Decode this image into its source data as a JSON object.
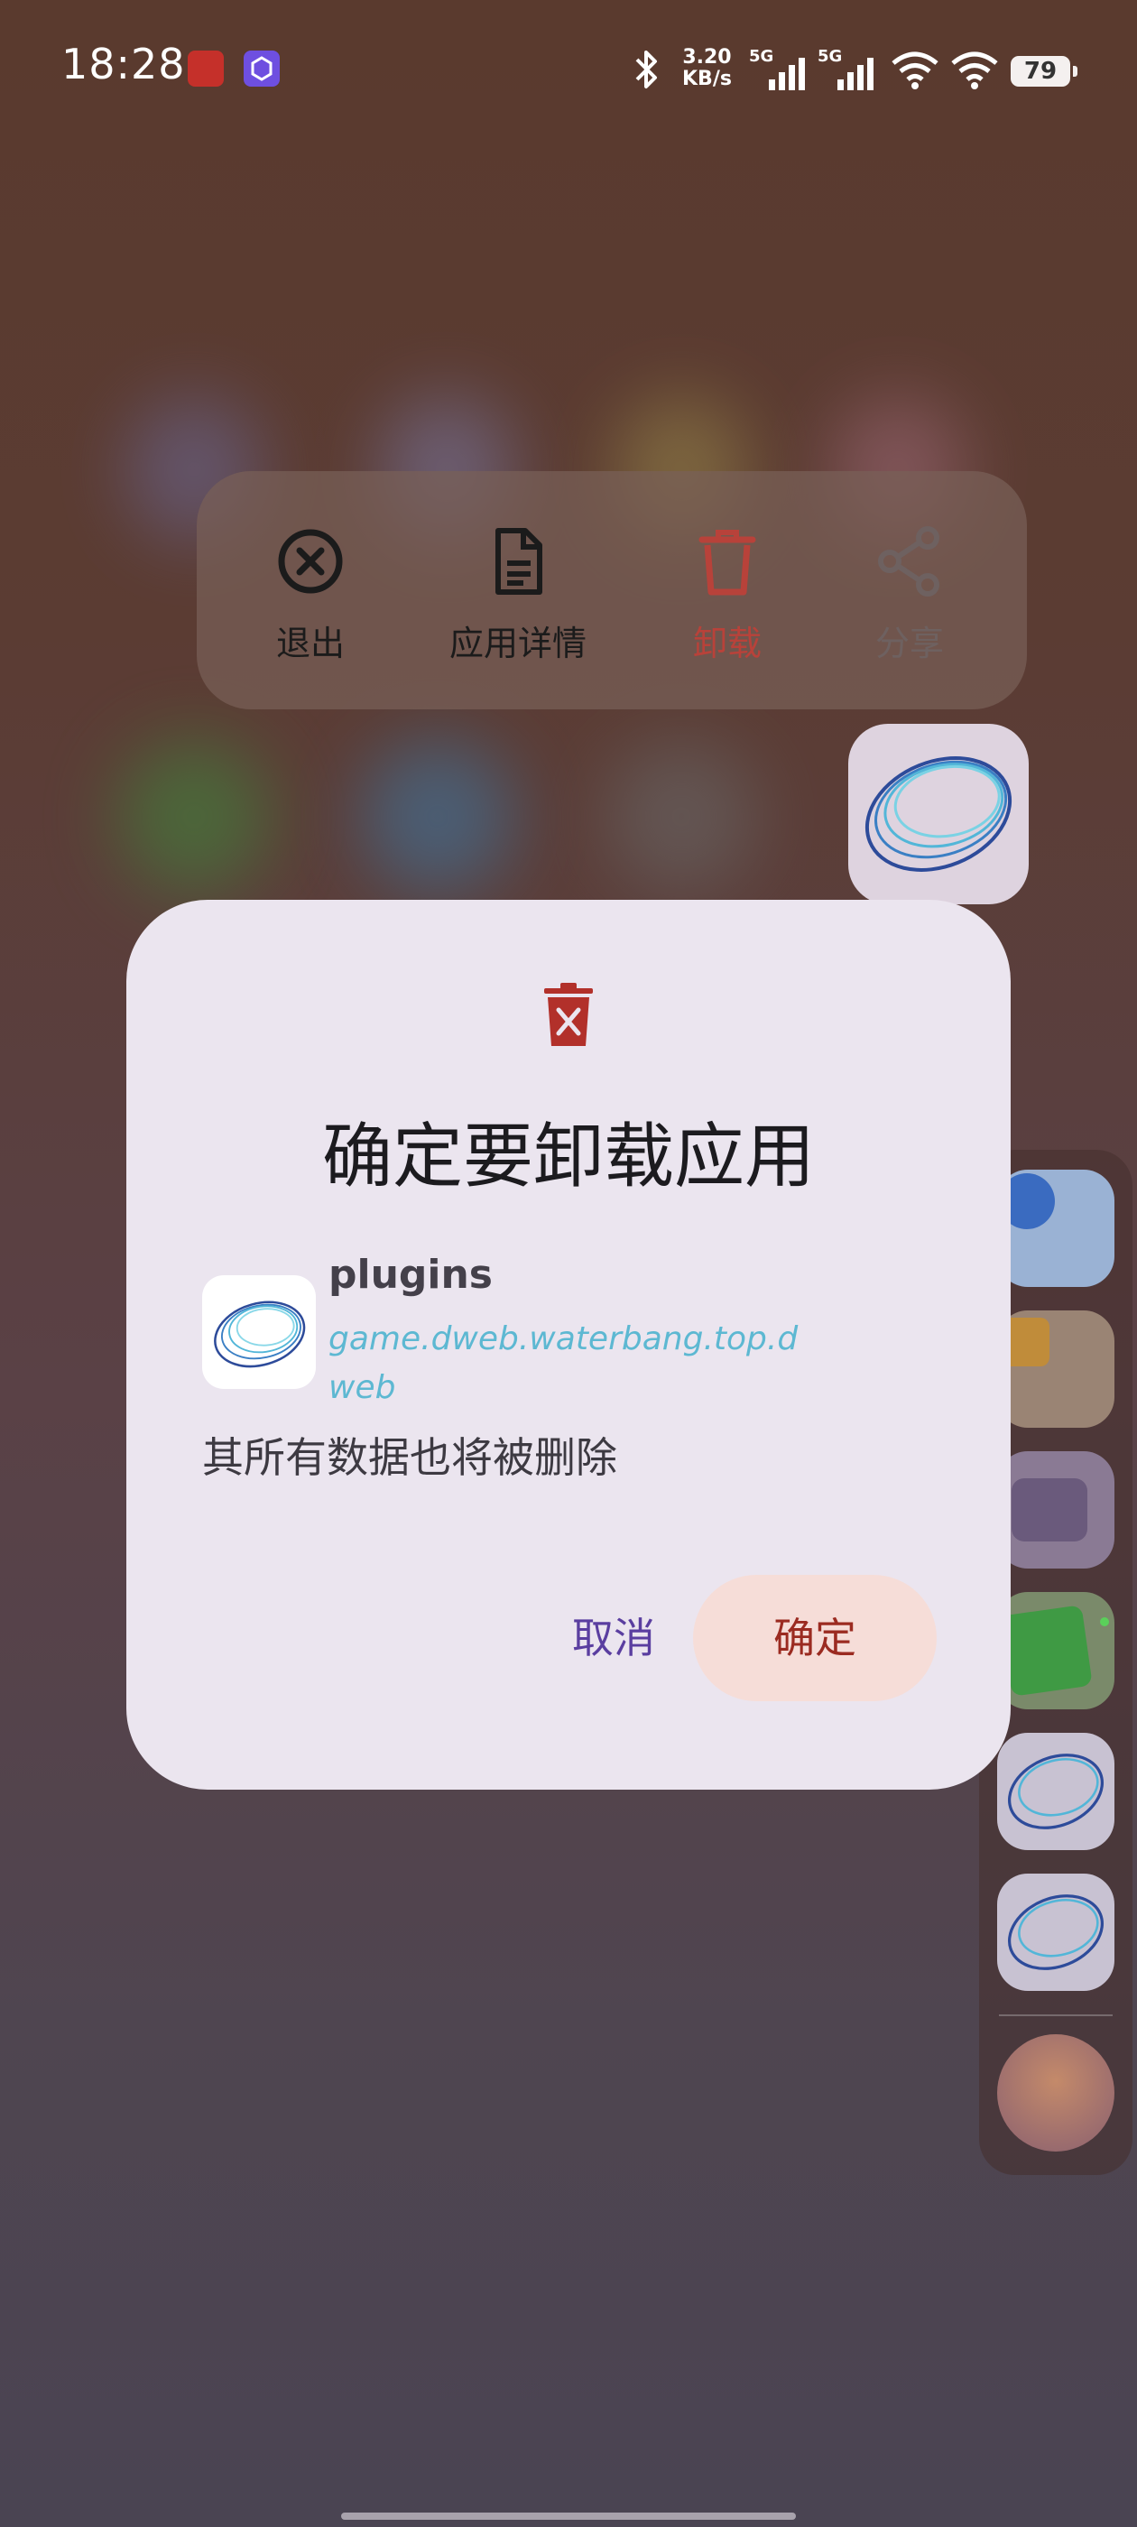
{
  "status_bar": {
    "time": "18:28",
    "net_speed": "3.20\nKB/s",
    "signal_1_label": "5G",
    "signal_2_label": "5G",
    "battery": "79"
  },
  "context_menu": {
    "items": [
      {
        "label": "退出",
        "icon": "close-circle-icon",
        "color": "#1b1b1b"
      },
      {
        "label": "应用详情",
        "icon": "document-icon",
        "color": "#1b1b1b"
      },
      {
        "label": "卸载",
        "icon": "trash-icon",
        "color": "#b8423a"
      },
      {
        "label": "分享",
        "icon": "share-icon",
        "color": "#6e6160"
      }
    ]
  },
  "dialog": {
    "icon": "trash-icon",
    "title": "确定要卸载应用",
    "app_name": "plugins",
    "app_package": "game.dweb.waterbang.top.dweb",
    "message": "其所有数据也将被删除",
    "cancel_label": "取消",
    "confirm_label": "确定"
  },
  "colors": {
    "dialog_bg": "#ebe5ef",
    "confirm_bg": "#f6ddd8",
    "confirm_text": "#9b2b21",
    "cancel_text": "#5a3ea0",
    "package_text": "#5db8d2"
  }
}
